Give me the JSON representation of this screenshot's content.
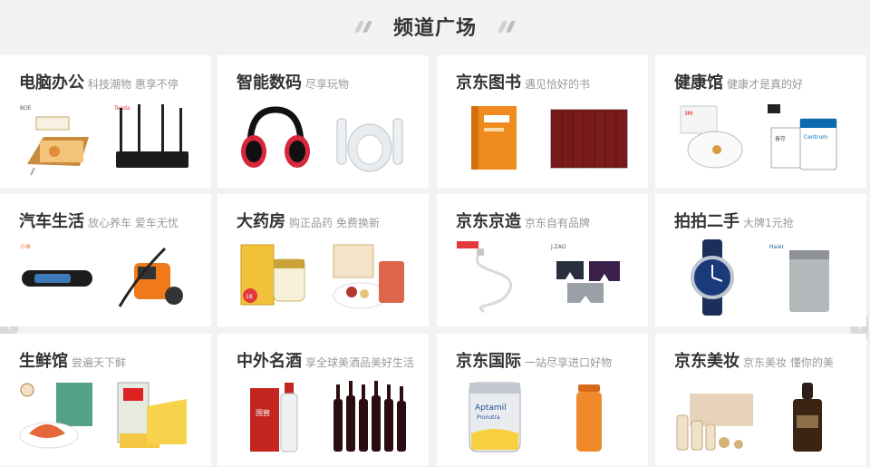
{
  "header": {
    "title": "频道广场"
  },
  "channels": [
    {
      "name": "电脑办公",
      "sub": "科技潮物 惠享不停"
    },
    {
      "name": "智能数码",
      "sub": "尽享玩物"
    },
    {
      "name": "京东图书",
      "sub": "遇见恰好的书"
    },
    {
      "name": "健康馆",
      "sub": "健康才是真的好"
    },
    {
      "name": "汽车生活",
      "sub": "放心养车 爱车无忧"
    },
    {
      "name": "大药房",
      "sub": "购正品药 免费换新"
    },
    {
      "name": "京东京造",
      "sub": "京东自有品牌"
    },
    {
      "name": "拍拍二手",
      "sub": "大牌1元抢"
    },
    {
      "name": "生鲜馆",
      "sub": "尝遍天下鲜"
    },
    {
      "name": "中外名酒",
      "sub": "享全球美酒品美好生活"
    },
    {
      "name": "京东国际",
      "sub": "一站尽享进口好物"
    },
    {
      "name": "京东美妆",
      "sub": "京东美妆 懂你的美"
    }
  ],
  "product_text": {
    "boe": "BOE",
    "tenda": "Tenda",
    "mi_brand": "小米",
    "jzao": "J.ZAO",
    "haier": "Haier",
    "aptamil": "Aptamil",
    "pronutra": "Pronutra",
    "centrum": "Centrum",
    "centrum_cn": "善存",
    "baijiu": "国窖",
    "mask_brand": "3M",
    "pill_price": "18"
  },
  "colors": {
    "accent": "#e4393c",
    "title": "#333333",
    "subtitle": "#999999",
    "background": "#f2f2f2"
  }
}
